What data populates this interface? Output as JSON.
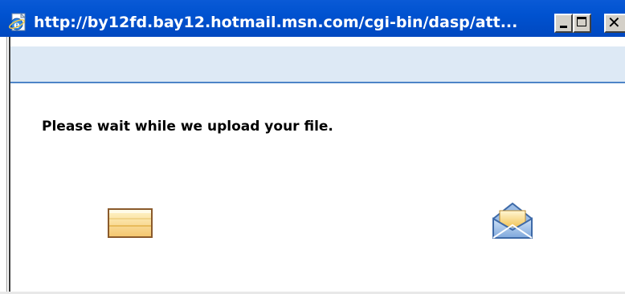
{
  "window": {
    "title": "http://by12fd.bay12.hotmail.msn.com/cgi-bin/dasp/att...",
    "title_bar_color": "#0052d0",
    "icons": {
      "app": "ie-page-icon",
      "minimize": "minimize-icon",
      "maximize": "maximize-icon",
      "close": "close-icon"
    },
    "close_glyph": "✕"
  },
  "header": {
    "band_color": "#dde9f5",
    "accent_color": "#4d84c7"
  },
  "main": {
    "message": "Please wait while we upload your file.",
    "source_icon": "file-icon",
    "destination_icon": "open-envelope-icon"
  }
}
